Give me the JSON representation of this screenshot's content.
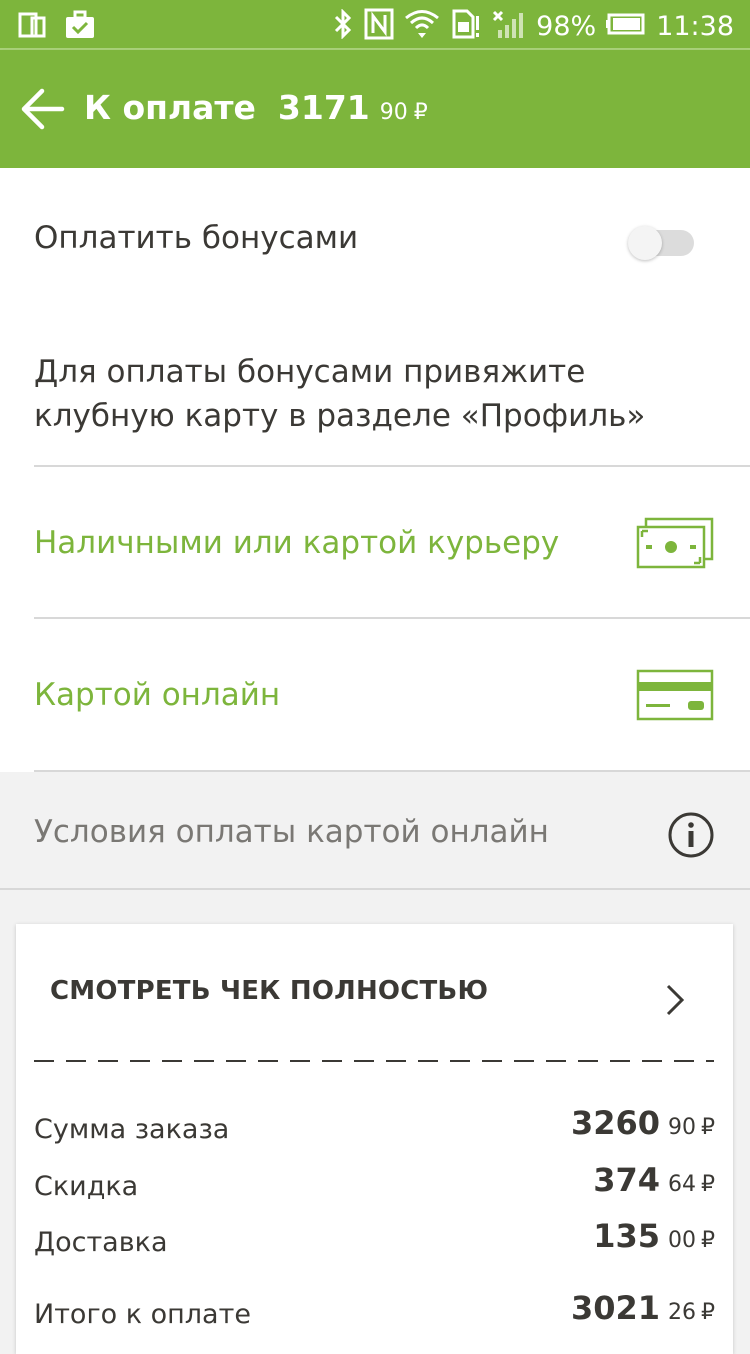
{
  "status_bar": {
    "battery": "98%",
    "time": "11:38"
  },
  "header": {
    "title": "К оплате",
    "amount_int": "3171",
    "amount_frac": "90",
    "currency": "₽"
  },
  "bonus": {
    "label": "Оплатить бонусами",
    "toggle_on": false,
    "hint": "Для оплаты бонусами привяжите клубную карту в разделе «Профиль»"
  },
  "payment_methods": [
    {
      "label": "Наличными или картой курьеру",
      "icon": "cash-icon"
    },
    {
      "label": "Картой онлайн",
      "icon": "credit-card-icon"
    }
  ],
  "conditions": {
    "label": "Условия оплаты картой онлайн",
    "icon": "info-icon"
  },
  "receipt": {
    "view_full_label": "СМОТРЕТЬ ЧЕК ПОЛНОСТЬЮ",
    "rows": [
      {
        "label": "Сумма заказа",
        "int": "3260",
        "frac": "90",
        "currency": "₽"
      },
      {
        "label": "Скидка",
        "int": "374",
        "frac": "64",
        "currency": "₽"
      },
      {
        "label": "Доставка",
        "int": "135",
        "frac": "00",
        "currency": "₽"
      },
      {
        "label": "Итого к оплате",
        "int": "3021",
        "frac": "26",
        "currency": "₽"
      }
    ]
  },
  "colors": {
    "brand_green": "#7db53c",
    "text_dark": "#3b3935",
    "background_gray": "#f2f2f2"
  }
}
